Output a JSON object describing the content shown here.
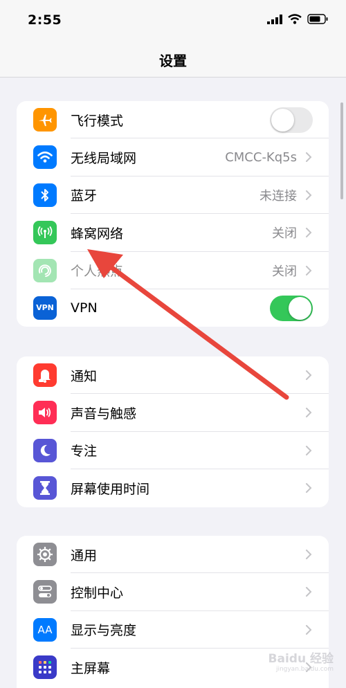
{
  "status_bar": {
    "time": "2:55"
  },
  "nav": {
    "title": "设置"
  },
  "groups": [
    {
      "rows": [
        {
          "label": "飞行模式",
          "icon": "airplane-icon",
          "color": "#ff9500",
          "control": "toggle",
          "toggle_on": false
        },
        {
          "label": "无线局域网",
          "icon": "wifi-icon",
          "color": "#007aff",
          "value": "CMCC-Kq5s"
        },
        {
          "label": "蓝牙",
          "icon": "bluetooth-icon",
          "color": "#007aff",
          "value": "未连接"
        },
        {
          "label": "蜂窝网络",
          "icon": "cellular-icon",
          "color": "#34c759",
          "value": "关闭"
        },
        {
          "label": "个人热点",
          "icon": "hotspot-icon",
          "color": "#34c759",
          "value": "关闭",
          "disabled": true
        },
        {
          "label": "VPN",
          "icon": "vpn-icon",
          "color": "#0a62d6",
          "icon_text": "VPN",
          "control": "toggle",
          "toggle_on": true
        }
      ]
    },
    {
      "rows": [
        {
          "label": "通知",
          "icon": "notification-bell-icon",
          "color": "#ff3b30"
        },
        {
          "label": "声音与触感",
          "icon": "speaker-icon",
          "color": "#ff2d55"
        },
        {
          "label": "专注",
          "icon": "moon-icon",
          "color": "#5856d6"
        },
        {
          "label": "屏幕使用时间",
          "icon": "hourglass-icon",
          "color": "#5856d6"
        }
      ]
    },
    {
      "rows": [
        {
          "label": "通用",
          "icon": "gear-icon",
          "color": "#8e8e93"
        },
        {
          "label": "控制中心",
          "icon": "control-center-icon",
          "color": "#8e8e93"
        },
        {
          "label": "显示与亮度",
          "icon": "display-brightness-icon",
          "color": "#007aff",
          "icon_text": "AA"
        },
        {
          "label": "主屏幕",
          "icon": "home-screen-icon",
          "color": "#3a3ac8"
        }
      ]
    }
  ],
  "colors": {
    "toggle_on": "#34c759",
    "toggle_off": "#e9e9ea",
    "annotation_arrow": "#e8463c"
  },
  "watermark": {
    "text": "Baidu 经验",
    "sub": "jingyan.baidu.com"
  }
}
